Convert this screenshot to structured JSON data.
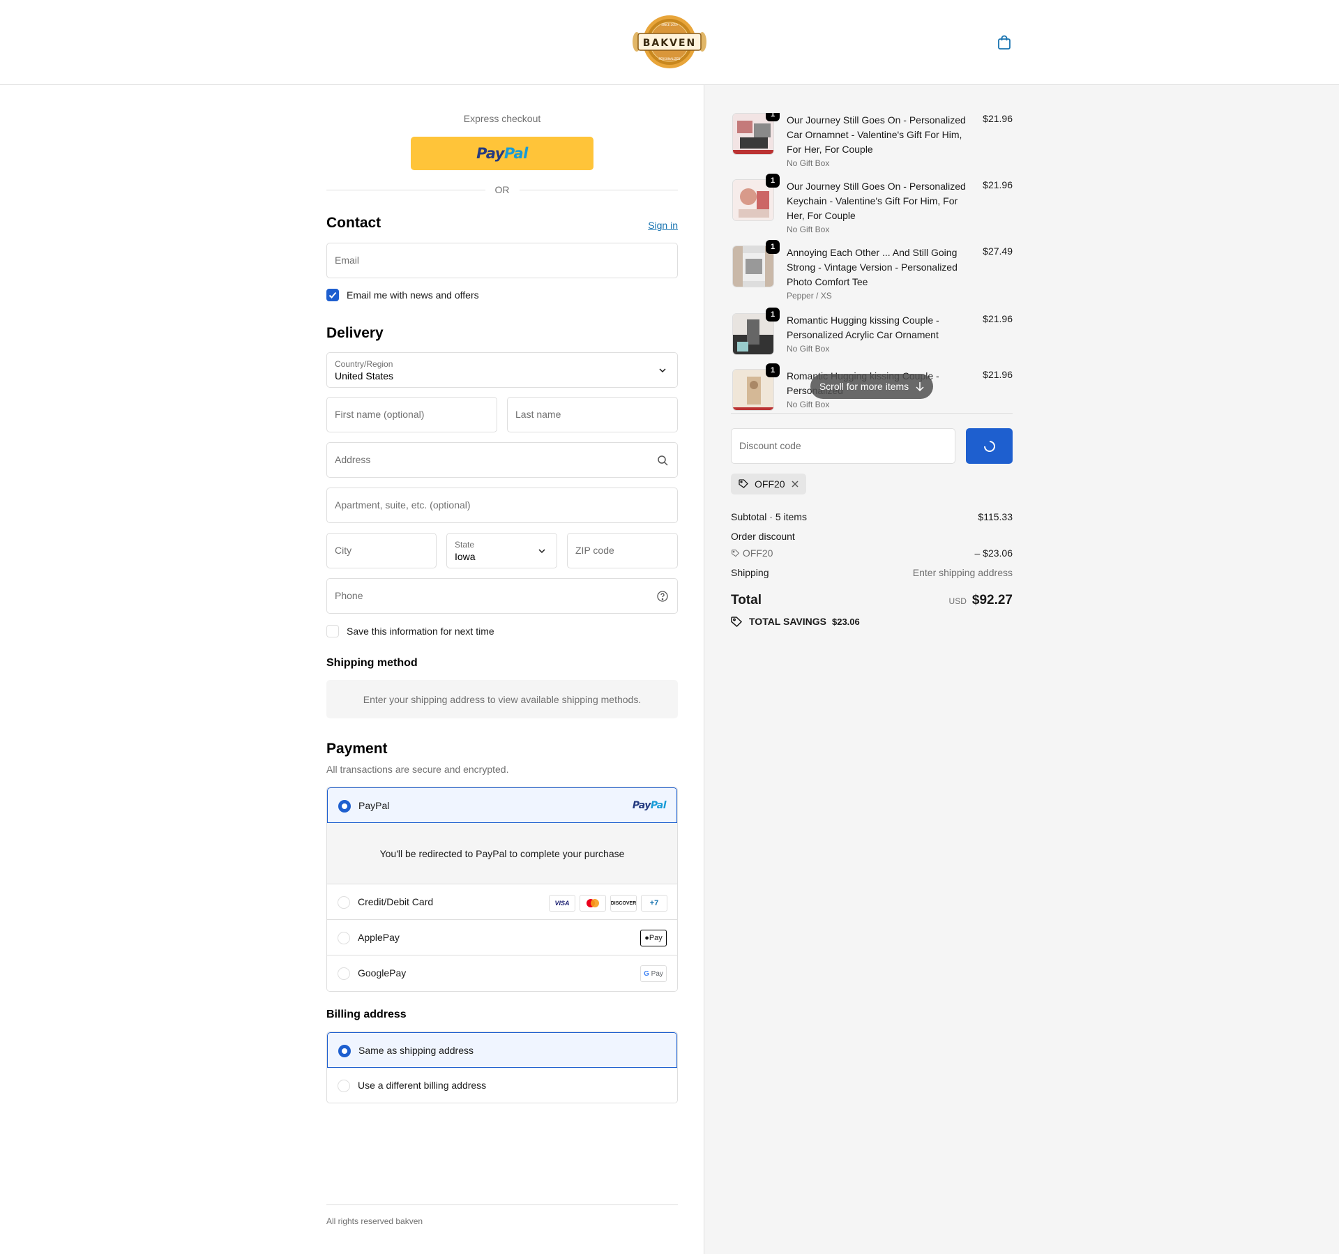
{
  "header": {
    "brand_name": "BAKVEN",
    "brand_tagline_top": "SINCE 2019",
    "brand_tagline_bottom": "PERSONALIZED",
    "cart_icon": "shopping-bag-icon"
  },
  "express": {
    "label": "Express checkout",
    "paypal_part1": "Pay",
    "paypal_part2": "Pal",
    "or_label": "OR"
  },
  "contact": {
    "title": "Contact",
    "sign_in": "Sign in",
    "email_placeholder": "Email",
    "newsletter_label": "Email me with news and offers",
    "newsletter_checked": true
  },
  "delivery": {
    "title": "Delivery",
    "country_label": "Country/Region",
    "country_value": "United States",
    "first_name_placeholder": "First name (optional)",
    "last_name_placeholder": "Last name",
    "address_placeholder": "Address",
    "apartment_placeholder": "Apartment, suite, etc. (optional)",
    "city_placeholder": "City",
    "state_label": "State",
    "state_value": "Iowa",
    "zip_placeholder": "ZIP code",
    "phone_placeholder": "Phone",
    "save_info_label": "Save this information for next time",
    "save_info_checked": false
  },
  "shipping_method": {
    "title": "Shipping method",
    "message": "Enter your shipping address to view available shipping methods."
  },
  "payment": {
    "title": "Payment",
    "subtitle": "All transactions are secure and encrypted.",
    "options": [
      {
        "label": "PayPal",
        "selected": true
      },
      {
        "label": "Credit/Debit Card",
        "selected": false
      },
      {
        "label": "ApplePay",
        "selected": false
      },
      {
        "label": "GooglePay",
        "selected": false
      }
    ],
    "redirect_message": "You'll be redirected to PayPal to complete your purchase",
    "card_brands": [
      "VISA",
      "DISCOVER",
      "+7"
    ],
    "applepay_badge": "Pay",
    "googlepay_badge": "Pay"
  },
  "billing": {
    "title": "Billing address",
    "options": [
      {
        "label": "Same as shipping address",
        "selected": true
      },
      {
        "label": "Use a different billing address",
        "selected": false
      }
    ]
  },
  "footer": {
    "text": "All rights reserved bakven"
  },
  "order": {
    "items": [
      {
        "name": "Our Journey Still Goes On - Personalized Car Ornamnet - Valentine's Gift For Him, For Her, For Couple",
        "variant": "No Gift Box",
        "price": "$21.96",
        "qty": "1"
      },
      {
        "name": "Our Journey Still Goes On - Personalized Keychain - Valentine's Gift For Him, For Her, For Couple",
        "variant": "No Gift Box",
        "price": "$21.96",
        "qty": "1"
      },
      {
        "name": "Annoying Each Other ... And Still Going Strong - Vintage Version - Personalized Photo Comfort Tee",
        "variant": "Pepper / XS",
        "price": "$27.49",
        "qty": "1"
      },
      {
        "name": "Romantic Hugging kissing Couple - Personalized Acrylic Car Ornament",
        "variant": "No Gift Box",
        "price": "$21.96",
        "qty": "1"
      },
      {
        "name": "Romantic Hugging kissing Couple - Personalized",
        "variant": "No Gift Box",
        "price": "$21.96",
        "qty": "1"
      }
    ],
    "scroll_hint": "Scroll for more items",
    "discount_placeholder": "Discount code",
    "applied_code": "OFF20",
    "subtotal_label": "Subtotal · 5 items",
    "subtotal_value": "$115.33",
    "order_discount_label": "Order discount",
    "discount_code": "OFF20",
    "discount_value": "– $23.06",
    "shipping_label": "Shipping",
    "shipping_value": "Enter shipping address",
    "total_label": "Total",
    "currency": "USD",
    "total_value": "$92.27",
    "savings_label": "TOTAL SAVINGS",
    "savings_value": "$23.06"
  },
  "colors": {
    "accent": "#1e5fcf",
    "paypal_yellow": "#ffc439",
    "link": "#1773b0",
    "logo_gold": "#c8871e"
  }
}
